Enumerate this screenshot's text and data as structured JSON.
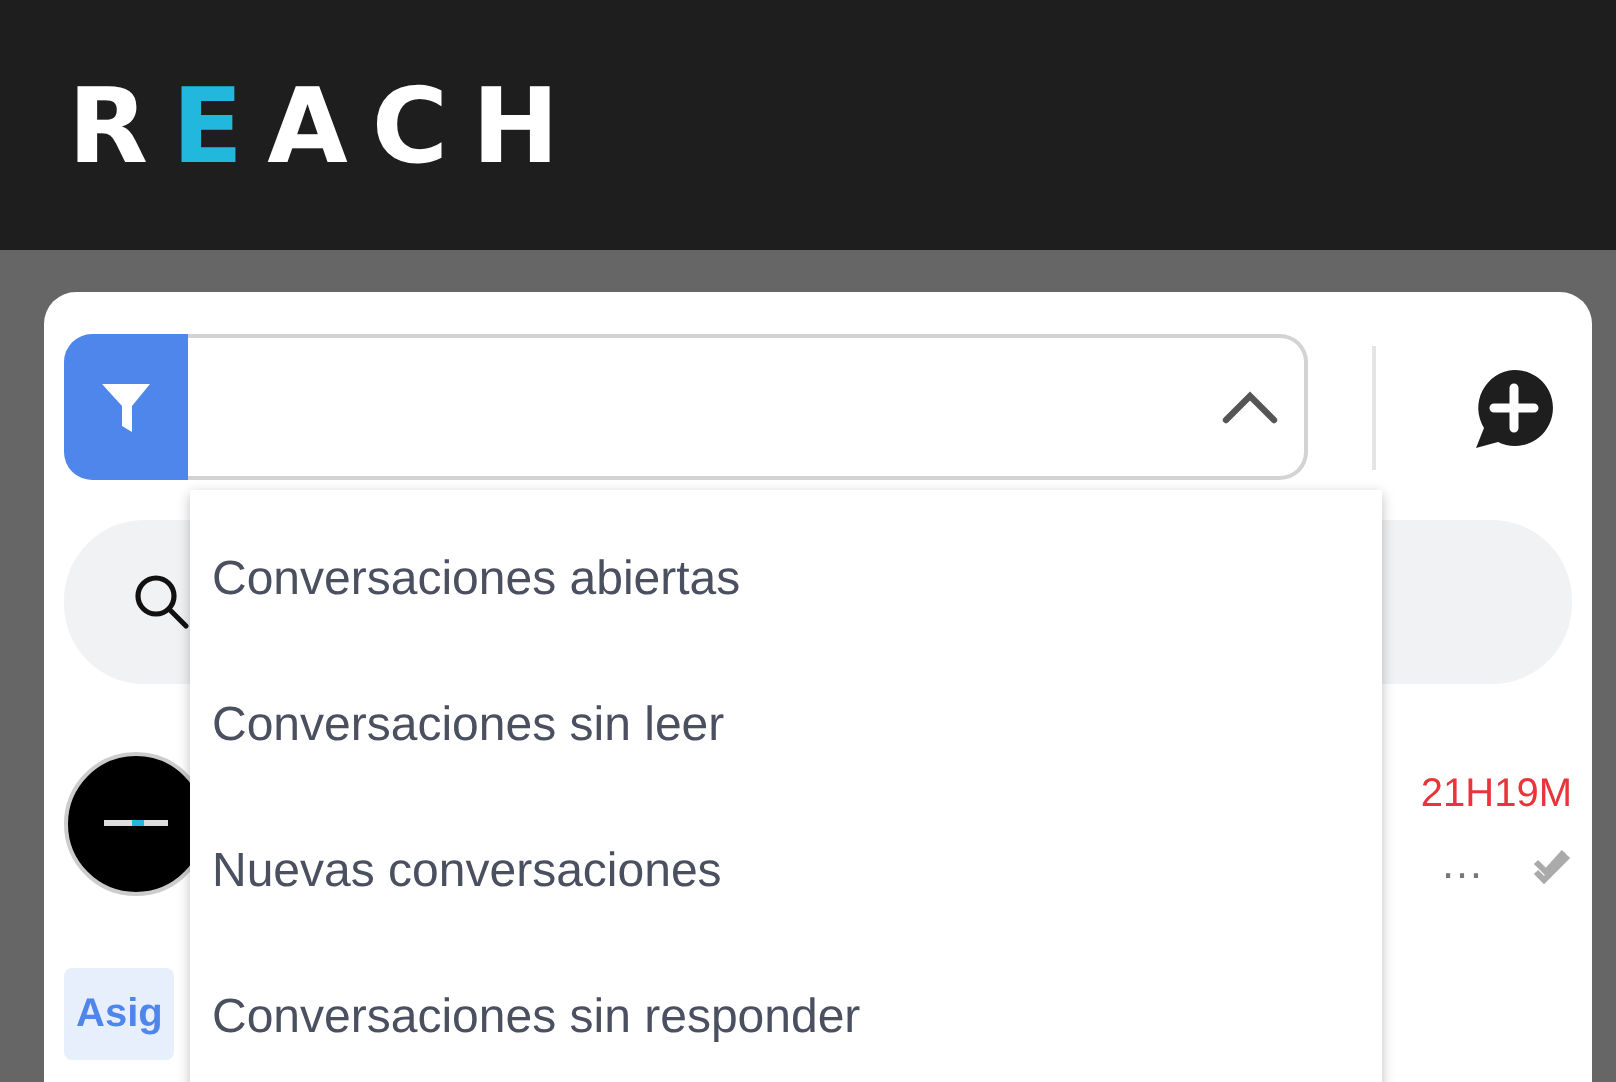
{
  "header": {
    "logo": [
      {
        "text": "R",
        "accent": false
      },
      {
        "text": "E",
        "accent": true
      },
      {
        "text": "ACH",
        "accent": false
      }
    ]
  },
  "filter": {
    "expanded": true,
    "options": [
      {
        "label": "Conversaciones abiertas"
      },
      {
        "label": "Conversaciones sin leer"
      },
      {
        "label": "Nuevas conversaciones"
      },
      {
        "label": "Conversaciones sin responder"
      }
    ]
  },
  "conversation": {
    "time": "21H19M",
    "preview": "…",
    "read": true,
    "tag": "Asig"
  }
}
